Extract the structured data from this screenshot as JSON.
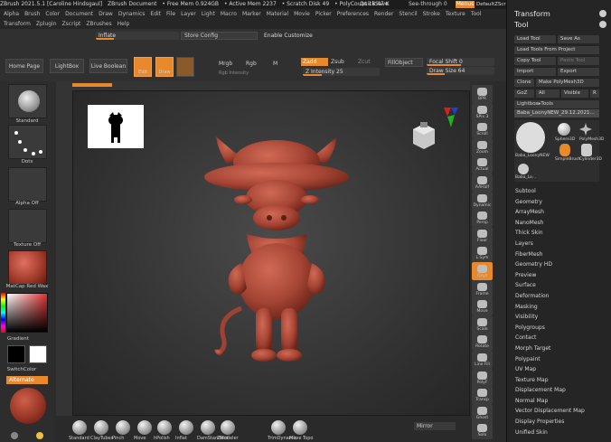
{
  "titlebar": {
    "app": "ZBrush 2021.5.1 [Caroline Hindsgaul]",
    "doc": "ZBrush Document",
    "free_mem": "• Free Mem 0.924GB",
    "active_mem": "• Active Mem 2237",
    "scratch": "• Scratch Disk 49",
    "polycount": "• PolyCount 18.47 K",
    "quicksave": "QuickSave",
    "see_through": "See-through 0",
    "menus": "Menus",
    "script": "DefaultZScript"
  },
  "menus": {
    "row1": [
      "Alpha",
      "Brush",
      "Color",
      "Document",
      "Draw",
      "Dynamics",
      "Edit",
      "File",
      "Layer",
      "Light",
      "Macro",
      "Marker",
      "Material",
      "Movie",
      "Picker",
      "Preferences",
      "Render",
      "Stencil",
      "Stroke",
      "Texture",
      "Tool"
    ],
    "row2": [
      "Transform",
      "Zplugin",
      "Zscript",
      "ZBrushes",
      "Help"
    ]
  },
  "shelf": {
    "intbtn": "Inflate",
    "store_config": "Store Config",
    "enable_customize": "Enable Customize",
    "home_page": "Home Page",
    "lightbox": "LightBox",
    "live_boolean": "Live Boolean",
    "edit": "Edit",
    "draw": "Draw",
    "mrgb": "Mrgb",
    "rgb": "Rgb",
    "m": "M",
    "rgb_intensity": "Rgb Intensity",
    "zadd": "Zadd",
    "zsub": "Zsub",
    "zcut": "Zcut",
    "z_intensity": "Z Intensity 25",
    "fill_object": "FillObject",
    "focal_shift": "Focal Shift 0",
    "draw_size": "Draw Size 64"
  },
  "lefttray": {
    "brush": "Standard",
    "stroke": "Dots",
    "alpha": "Alpha Off",
    "texture": "Texture Off",
    "material": "MatCap Red Wax",
    "gradient": "Gradient",
    "switch_color": "SwitchColor",
    "alternate": "Alternate"
  },
  "righttools": [
    "BPR",
    "SPix 3",
    "Scroll",
    "Zoom",
    "Actual",
    "AAHalf",
    "Dynamic",
    "Persp",
    "Floor",
    "L.Sym",
    "Qxyz",
    "Frame",
    "Move",
    "Scale",
    "Rotate",
    "Line Fill",
    "PolyF",
    "Transp",
    "Ghost",
    "Solo"
  ],
  "toolpanel": {
    "title": "Transform",
    "tool": "Tool",
    "load_tool": "Load Tool",
    "save_as": "Save As",
    "load_from_project": "Load Tools From Project",
    "copy_tool": "Copy Tool",
    "paste_tool": "Paste Tool",
    "import": "Import",
    "export": "Export",
    "clone": "Clone",
    "make_polymesh": "Make PolyMesh3D",
    "goz": "GoZ",
    "all": "All",
    "visible": "Visible",
    "r": "R",
    "lightbox_tools": "Lightbox▸Tools",
    "current_tool": "Baba_LoonyNEW_29.12.2021...",
    "thumbs": [
      "Baba_LoonyNEW",
      "Sphere3D",
      "PolyMesh3D",
      "SimpleBrush",
      "Cylinder3D",
      "Baba_Lo..."
    ],
    "subpalettes": [
      "Subtool",
      "Geometry",
      "ArrayMesh",
      "NanoMesh",
      "Thick Skin",
      "Layers",
      "FiberMesh",
      "Geometry HD",
      "Preview",
      "Surface",
      "Deformation",
      "Masking",
      "Visibility",
      "Polygroups",
      "Contact",
      "Morph Target",
      "Polypaint",
      "UV Map",
      "Texture Map",
      "Displacement Map",
      "Normal Map",
      "Vector Displacement Map",
      "Display Properties",
      "Unified Skin"
    ]
  },
  "brushbar": {
    "brushes": [
      "Standard",
      "ClayTubes",
      "Pinch",
      "Move",
      "hPolish",
      "Inflat",
      "DamStandard",
      "ZModeler",
      "TrimDynamic",
      "Move Topo"
    ],
    "mirror": "Mirror"
  },
  "colors": {
    "accent": "#e8892b",
    "model": "#b1503f",
    "panel": "#252525"
  }
}
